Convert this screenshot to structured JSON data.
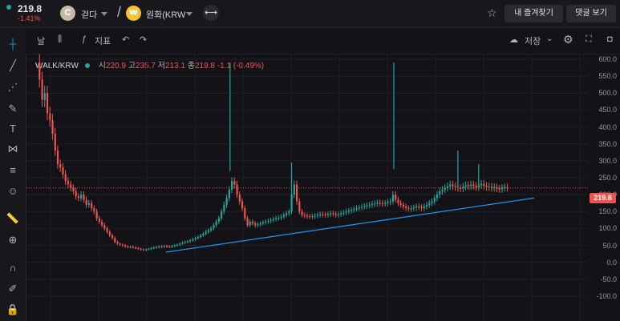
{
  "header": {
    "price": "219.8",
    "change": "-1.41%",
    "base": {
      "symbol": "C",
      "name": "걷다"
    },
    "quote": {
      "symbol": "₩",
      "name": "원화(KRW"
    },
    "buttons": {
      "favorites": "내 즐겨찾기",
      "comments": "댓글 보기"
    }
  },
  "toolbar": {
    "indicators_label": "지표",
    "save_label": "저장"
  },
  "legend": {
    "symbol": "WALK/KRW",
    "open_label": "시",
    "open": "220.9",
    "high_label": "고",
    "high": "235.7",
    "low_label": "저",
    "low": "213.1",
    "close_label": "종",
    "close": "219.8",
    "change": "-1.1 (-0.49%)"
  },
  "colors": {
    "up": "#26a69a",
    "down": "#ef5350",
    "trendline": "#2196f3",
    "background": "#131317"
  },
  "chart_data": {
    "type": "candlestick",
    "y_ticks": [
      "600.0",
      "550.0",
      "500.0",
      "450.0",
      "400.0",
      "350.0",
      "300.0",
      "250.0",
      "200.0",
      "150.0",
      "100.0",
      "50.0",
      "0.0",
      "-50.0",
      "-100.0"
    ],
    "ylim": [
      -110,
      620
    ],
    "last_price": 219.8,
    "last_price_label": "219.8",
    "close_path": [
      [
        0,
        590
      ],
      [
        3,
        540
      ],
      [
        6,
        480
      ],
      [
        9,
        500
      ],
      [
        12,
        440
      ],
      [
        15,
        420
      ],
      [
        18,
        380
      ],
      [
        21,
        330
      ],
      [
        24,
        290
      ],
      [
        27,
        280
      ],
      [
        30,
        260
      ],
      [
        33,
        240
      ],
      [
        36,
        230
      ],
      [
        39,
        220
      ],
      [
        42,
        210
      ],
      [
        45,
        195
      ],
      [
        48,
        190
      ],
      [
        51,
        200
      ],
      [
        54,
        185
      ],
      [
        57,
        170
      ],
      [
        60,
        175
      ],
      [
        63,
        160
      ],
      [
        66,
        150
      ],
      [
        69,
        130
      ],
      [
        72,
        120
      ],
      [
        75,
        110
      ],
      [
        78,
        100
      ],
      [
        81,
        90
      ],
      [
        84,
        80
      ],
      [
        87,
        72
      ],
      [
        90,
        60
      ],
      [
        93,
        55
      ],
      [
        96,
        52
      ],
      [
        99,
        50
      ],
      [
        102,
        47
      ],
      [
        105,
        45
      ],
      [
        108,
        46
      ],
      [
        111,
        44
      ],
      [
        114,
        42
      ],
      [
        117,
        40
      ],
      [
        120,
        38
      ],
      [
        123,
        37
      ],
      [
        126,
        38
      ],
      [
        129,
        40
      ],
      [
        132,
        42
      ],
      [
        135,
        44
      ],
      [
        138,
        45
      ],
      [
        141,
        47
      ],
      [
        144,
        46
      ],
      [
        147,
        48
      ],
      [
        150,
        47
      ],
      [
        153,
        46
      ],
      [
        156,
        48
      ],
      [
        159,
        50
      ],
      [
        162,
        52
      ],
      [
        165,
        55
      ],
      [
        168,
        58
      ],
      [
        171,
        60
      ],
      [
        174,
        62
      ],
      [
        177,
        65
      ],
      [
        180,
        68
      ],
      [
        183,
        72
      ],
      [
        186,
        75
      ],
      [
        189,
        80
      ],
      [
        192,
        85
      ],
      [
        195,
        90
      ],
      [
        198,
        95
      ],
      [
        201,
        100
      ],
      [
        204,
        110
      ],
      [
        207,
        120
      ],
      [
        210,
        130
      ],
      [
        213,
        150
      ],
      [
        216,
        170
      ],
      [
        219,
        190
      ],
      [
        222,
        215
      ],
      [
        225,
        240
      ],
      [
        228,
        230
      ],
      [
        231,
        200
      ],
      [
        234,
        180
      ],
      [
        237,
        160
      ],
      [
        240,
        130
      ],
      [
        243,
        110
      ],
      [
        246,
        120
      ],
      [
        249,
        115
      ],
      [
        252,
        110
      ],
      [
        255,
        112
      ],
      [
        258,
        115
      ],
      [
        261,
        118
      ],
      [
        264,
        120
      ],
      [
        267,
        122
      ],
      [
        270,
        125
      ],
      [
        273,
        128
      ],
      [
        276,
        130
      ],
      [
        279,
        132
      ],
      [
        282,
        135
      ],
      [
        285,
        140
      ],
      [
        288,
        145
      ],
      [
        291,
        150
      ],
      [
        294,
        200
      ],
      [
        297,
        230
      ],
      [
        300,
        180
      ],
      [
        303,
        150
      ],
      [
        306,
        140
      ],
      [
        309,
        138
      ],
      [
        312,
        136
      ],
      [
        315,
        135
      ],
      [
        318,
        136
      ],
      [
        321,
        138
      ],
      [
        324,
        140
      ],
      [
        327,
        142
      ],
      [
        330,
        141
      ],
      [
        333,
        140
      ],
      [
        336,
        142
      ],
      [
        339,
        145
      ],
      [
        342,
        143
      ],
      [
        345,
        140
      ],
      [
        348,
        142
      ],
      [
        351,
        145
      ],
      [
        354,
        147
      ],
      [
        357,
        150
      ],
      [
        360,
        152
      ],
      [
        363,
        155
      ],
      [
        366,
        158
      ],
      [
        369,
        160
      ],
      [
        372,
        162
      ],
      [
        375,
        164
      ],
      [
        378,
        166
      ],
      [
        381,
        168
      ],
      [
        384,
        170
      ],
      [
        387,
        172
      ],
      [
        390,
        174
      ],
      [
        393,
        176
      ],
      [
        396,
        175
      ],
      [
        399,
        173
      ],
      [
        402,
        175
      ],
      [
        405,
        178
      ],
      [
        408,
        180
      ],
      [
        411,
        200
      ],
      [
        414,
        185
      ],
      [
        417,
        175
      ],
      [
        420,
        170
      ],
      [
        423,
        165
      ],
      [
        426,
        160
      ],
      [
        429,
        158
      ],
      [
        432,
        160
      ],
      [
        435,
        162
      ],
      [
        438,
        165
      ],
      [
        441,
        163
      ],
      [
        444,
        160
      ],
      [
        447,
        165
      ],
      [
        450,
        170
      ],
      [
        453,
        175
      ],
      [
        456,
        180
      ],
      [
        459,
        190
      ],
      [
        462,
        200
      ],
      [
        465,
        210
      ],
      [
        468,
        215
      ],
      [
        471,
        220
      ],
      [
        474,
        225
      ],
      [
        477,
        230
      ],
      [
        480,
        225
      ],
      [
        483,
        222
      ],
      [
        486,
        220
      ],
      [
        489,
        218
      ],
      [
        492,
        224
      ],
      [
        495,
        228
      ],
      [
        498,
        225
      ],
      [
        501,
        230
      ],
      [
        504,
        226
      ],
      [
        507,
        222
      ],
      [
        510,
        228
      ],
      [
        513,
        232
      ],
      [
        516,
        226
      ],
      [
        519,
        222
      ],
      [
        522,
        224
      ],
      [
        525,
        220
      ],
      [
        528,
        222
      ],
      [
        531,
        218
      ],
      [
        534,
        216
      ],
      [
        537,
        220
      ],
      [
        540,
        222
      ],
      [
        543,
        219.8
      ]
    ],
    "wick_spikes": [
      [
        223,
        270
      ],
      [
        294,
        295
      ],
      [
        412,
        275
      ],
      [
        486,
        330
      ],
      [
        510,
        290
      ]
    ],
    "trendline": [
      [
        150,
        30
      ],
      [
        575,
        190
      ]
    ]
  }
}
